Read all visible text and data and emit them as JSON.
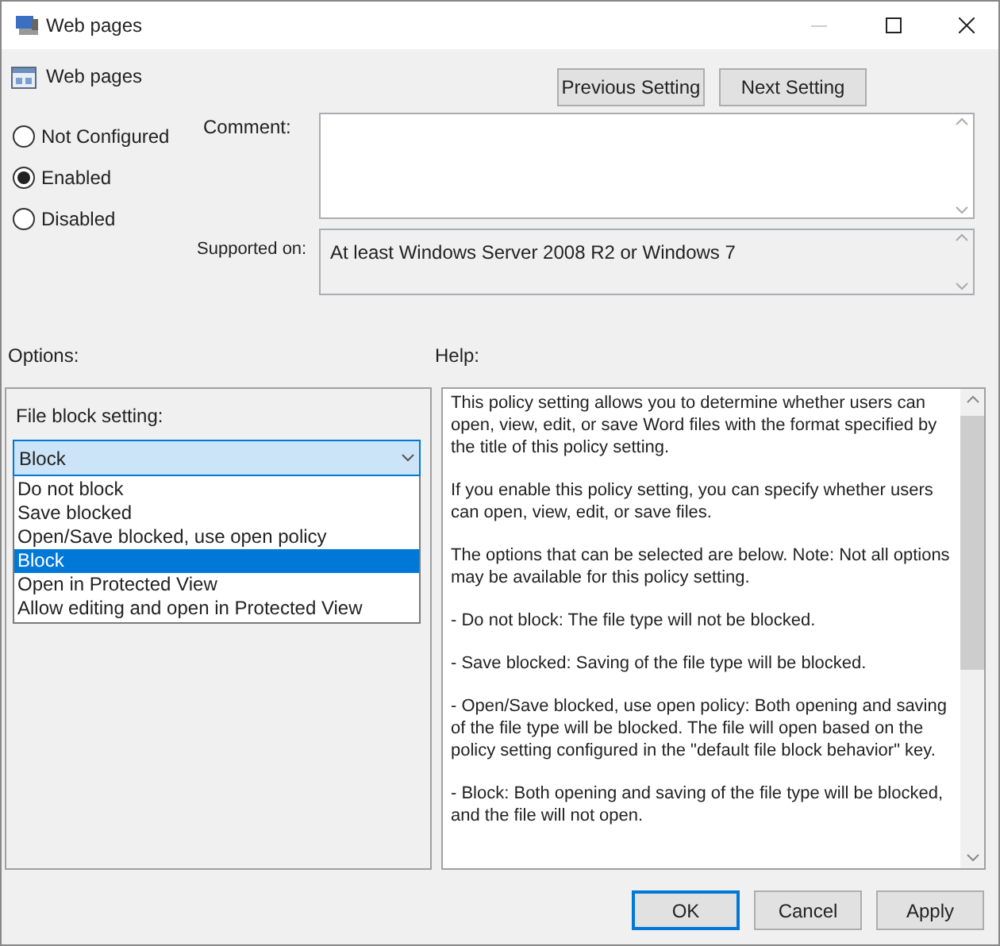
{
  "window": {
    "title": "Web pages"
  },
  "header": {
    "title": "Web pages",
    "buttons": [
      "Previous Setting",
      "Next Setting"
    ]
  },
  "state_options": [
    {
      "label": "Not Configured",
      "selected": false
    },
    {
      "label": "Enabled",
      "selected": true
    },
    {
      "label": "Disabled",
      "selected": false
    }
  ],
  "comment": {
    "label": "Comment:"
  },
  "supported_on": {
    "label": "Supported on:",
    "value": "At least Windows Server 2008 R2 or Windows 7"
  },
  "options": {
    "heading": "Options:",
    "field_label": "File block setting:",
    "dropdown": {
      "value": "Block",
      "expanded": true,
      "items": [
        {
          "label": "Do not block",
          "selected": false
        },
        {
          "label": "Save blocked",
          "selected": false
        },
        {
          "label": "Open/Save blocked, use open policy",
          "selected": false
        },
        {
          "label": "Block",
          "selected": true
        },
        {
          "label": "Open in Protected View",
          "selected": false
        },
        {
          "label": "Allow editing and open in Protected View",
          "selected": false
        }
      ]
    }
  },
  "help": {
    "heading": "Help:",
    "paragraphs": [
      "This policy setting allows you to determine whether users can open, view, edit, or save Word files with the format specified by the title of this policy setting.",
      "If you enable this policy setting, you can specify whether users can open, view, edit, or save files.",
      "The options that can be selected are below.  Note: Not all options may be available for this policy setting.",
      "- Do not block: The file type will not be blocked.",
      "- Save blocked: Saving of the file type will be blocked.",
      "- Open/Save blocked, use open policy: Both opening and saving of the file type will be blocked. The file will open based on the policy setting configured in the \"default file block behavior\" key.",
      "- Block: Both opening and saving of the file type will be blocked, and the file will not open."
    ]
  },
  "buttons": [
    {
      "label": "OK",
      "default": true
    },
    {
      "label": "Cancel",
      "default": false
    },
    {
      "label": "Apply",
      "default": false
    }
  ]
}
